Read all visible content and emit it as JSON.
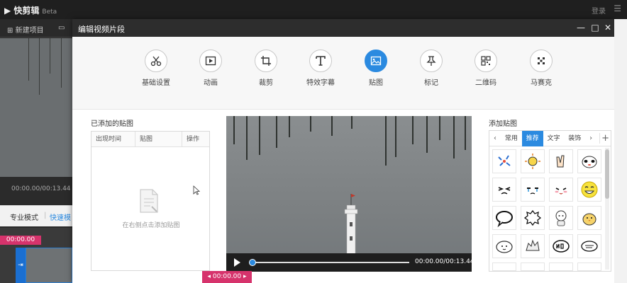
{
  "app": {
    "logo_text": "快剪辑",
    "beta_label": "Beta",
    "login_label": "登录",
    "menu_icon": "menu-icon",
    "toolbar": {
      "new_project": "新建项目"
    },
    "timecode": "00:00.00/00:13.44",
    "mode_pro": "专业模式",
    "mode_separator": "|",
    "mode_quick": "快速模",
    "track_timecode": "00:00.00",
    "colors": {
      "titlebar": "#1f1f1f",
      "accent_pink": "#d6336c",
      "accent_blue": "#2b8ae0"
    }
  },
  "dialog": {
    "title": "编辑视频片段",
    "controls": {
      "minimize": "—",
      "maximize": "□",
      "close": "✕"
    },
    "tabs": [
      {
        "label": "基础设置",
        "icon": "scissors-icon"
      },
      {
        "label": "动画",
        "icon": "play-box-icon"
      },
      {
        "label": "裁剪",
        "icon": "crop-icon"
      },
      {
        "label": "特效字幕",
        "icon": "text-t-icon"
      },
      {
        "label": "贴图",
        "icon": "image-icon"
      },
      {
        "label": "标记",
        "icon": "pin-icon"
      },
      {
        "label": "二维码",
        "icon": "qrcode-icon"
      },
      {
        "label": "马赛克",
        "icon": "mosaic-icon"
      }
    ],
    "active_tab": "贴图",
    "left_panel": {
      "title": "已添加的贴图",
      "columns": [
        "出现时间",
        "贴图",
        "操作"
      ],
      "empty_hint": "在右侧点击添加贴图"
    },
    "preview": {
      "time": "00:00.00/00:13.44",
      "progress": 0
    },
    "bottom_timecode": "00:00.00",
    "bottom_tc_left_arrow": "◂",
    "bottom_tc_right_arrow": "▸",
    "right_panel": {
      "title": "添加贴图",
      "categories": [
        "常用",
        "推荐",
        "文字",
        "装饰"
      ],
      "active_category": "推荐",
      "nav_prev": "‹",
      "nav_next": "›",
      "add_label": "+"
    }
  }
}
